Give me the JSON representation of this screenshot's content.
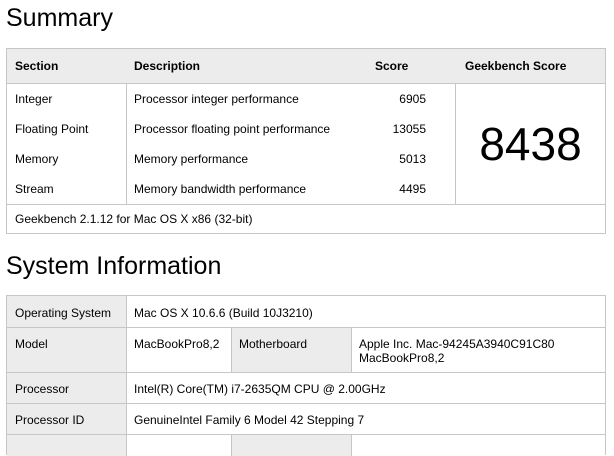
{
  "summary": {
    "heading": "Summary",
    "columns": {
      "section": "Section",
      "description": "Description",
      "score": "Score",
      "geekbench_score": "Geekbench Score"
    },
    "rows": [
      {
        "section": "Integer",
        "description": "Processor integer performance",
        "score": "6905"
      },
      {
        "section": "Floating Point",
        "description": "Processor floating point performance",
        "score": "13055"
      },
      {
        "section": "Memory",
        "description": "Memory performance",
        "score": "5013"
      },
      {
        "section": "Stream",
        "description": "Memory bandwidth performance",
        "score": "4495"
      }
    ],
    "geekbench_score": "8438",
    "footer": "Geekbench 2.1.12 for Mac OS X x86 (32-bit)"
  },
  "system_information": {
    "heading": "System Information",
    "operating_system": {
      "label": "Operating System",
      "value": "Mac OS X 10.6.6 (Build 10J3210)"
    },
    "model": {
      "label": "Model",
      "value": "MacBookPro8,2"
    },
    "motherboard": {
      "label": "Motherboard",
      "value_line1": "Apple Inc. Mac-94245A3940C91C80",
      "value_line2": "MacBookPro8,2"
    },
    "processor": {
      "label": "Processor",
      "value": "Intel(R) Core(TM) i7-2635QM CPU @ 2.00GHz"
    },
    "processor_id": {
      "label": "Processor ID",
      "value": "GenuineIntel Family 6 Model 42 Stepping 7"
    }
  }
}
